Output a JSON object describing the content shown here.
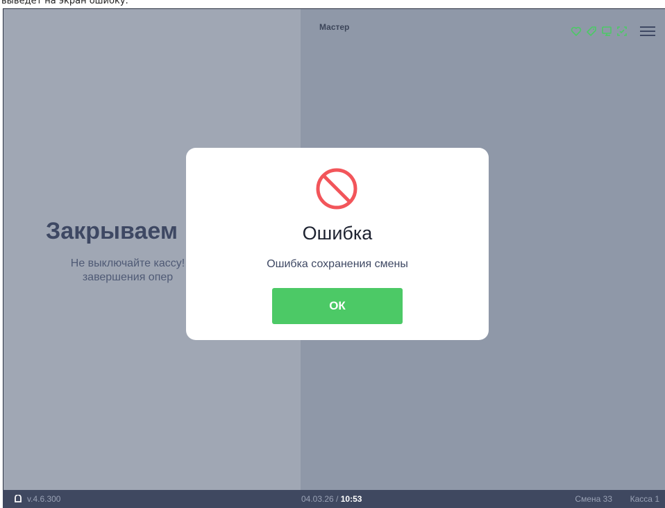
{
  "caption": "выведет на экран ошибку.",
  "header": {
    "cashier": "Мастер",
    "icons": [
      "heart-icon",
      "tag-icon",
      "monitor-icon",
      "scan-icon",
      "hamburger-menu-icon"
    ],
    "accent_color": "#4cc966"
  },
  "background_screen": {
    "heading": "Закрываем",
    "subtext_line1": "Не выключайте кассу!",
    "subtext_line2": "завершения опер"
  },
  "dialog": {
    "icon": "prohibited-icon",
    "icon_color": "#f2555a",
    "title": "Ошибка",
    "message": "Ошибка сохранения смены",
    "ok_label": "ОК"
  },
  "status_bar": {
    "version": "v.4.6.300",
    "date": "04.03.26",
    "separator": " / ",
    "time": "10:53",
    "shift": "Смена 33",
    "register": "Касса 1"
  }
}
